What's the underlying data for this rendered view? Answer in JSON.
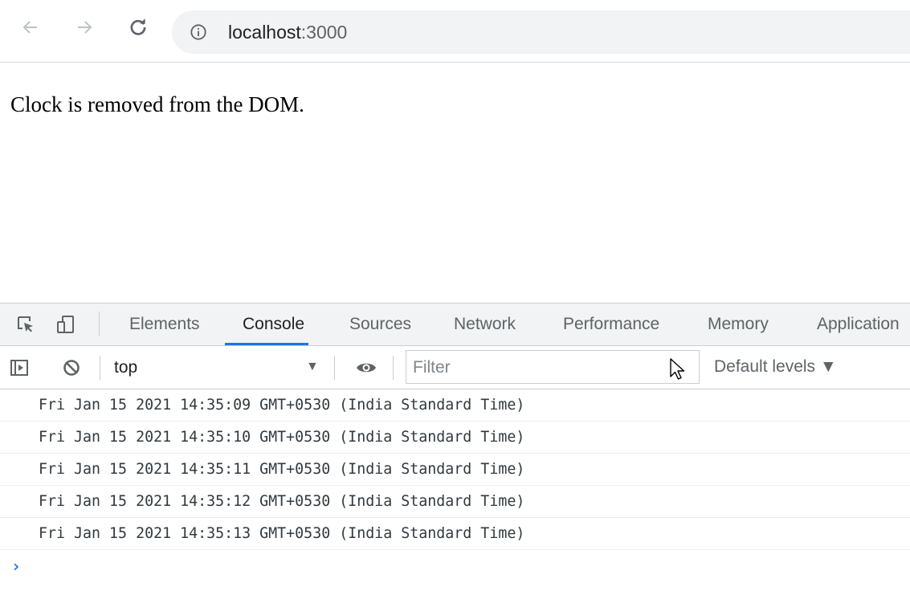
{
  "browser": {
    "back_icon": "arrow-left-icon",
    "forward_icon": "arrow-right-icon",
    "reload_icon": "reload-icon",
    "site_info_icon": "info-circle-icon",
    "url_host": "localhost",
    "url_port": ":3000"
  },
  "page": {
    "message": "Clock is removed from the DOM."
  },
  "devtools": {
    "tabs": [
      {
        "label": "Elements"
      },
      {
        "label": "Console"
      },
      {
        "label": "Sources"
      },
      {
        "label": "Network"
      },
      {
        "label": "Performance"
      },
      {
        "label": "Memory"
      },
      {
        "label": "Application"
      }
    ],
    "active_tab": "Console",
    "console": {
      "context": "top",
      "filter_placeholder": "Filter",
      "levels": "Default levels ▼",
      "prompt": "›",
      "logs": [
        "Fri Jan 15 2021 14:35:09 GMT+0530 (India Standard Time)",
        "Fri Jan 15 2021 14:35:10 GMT+0530 (India Standard Time)",
        "Fri Jan 15 2021 14:35:11 GMT+0530 (India Standard Time)",
        "Fri Jan 15 2021 14:35:12 GMT+0530 (India Standard Time)",
        "Fri Jan 15 2021 14:35:13 GMT+0530 (India Standard Time)"
      ]
    }
  },
  "colors": {
    "accent": "#1a73e8",
    "toolbar_bg": "#f1f3f4",
    "omnibox_bg": "#f1f3f4"
  }
}
